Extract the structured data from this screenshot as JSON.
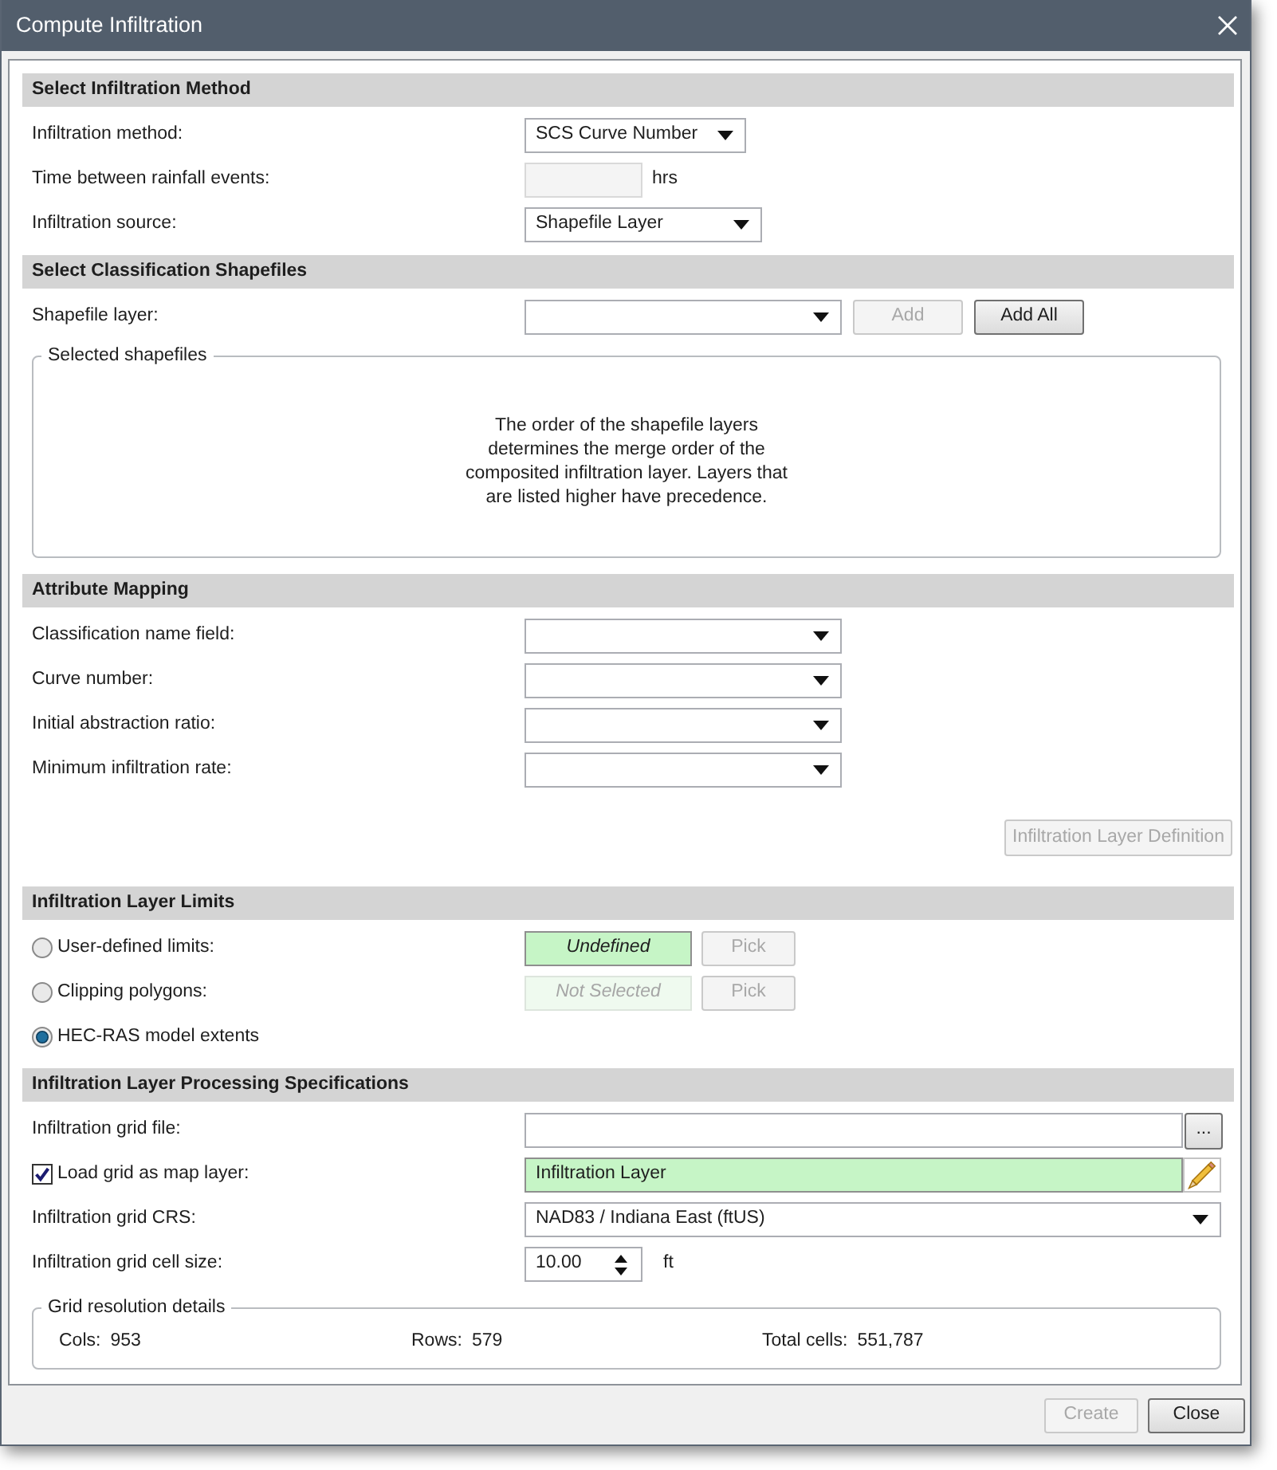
{
  "window": {
    "title": "Compute Infiltration"
  },
  "sections": [
    {
      "title": "Select Infiltration Method",
      "rows": [
        {
          "kind": "dropdown",
          "label": "Infiltration method:",
          "value": "SCS Curve Number"
        },
        {
          "kind": "number",
          "label": "Time between rainfall events:",
          "disabled": true,
          "unit": "hrs"
        },
        {
          "kind": "dropdown",
          "label": "Infiltration source:",
          "value": "Shapefile Layer"
        }
      ]
    },
    {
      "title": "Select Classification Shapefiles",
      "rows": [
        {
          "kind": "dropdown",
          "label": "Shapefile layer:",
          "buttons": [
            {
              "label": "Add",
              "disabled": true
            },
            {
              "label": "Add All",
              "disabled": false
            }
          ]
        }
      ],
      "group": {
        "kind": "message",
        "title": "Selected shapefiles",
        "message": "The order of the shapefile layers determines the merge order of the composited infiltration layer. Layers that are listed higher have precedence."
      }
    },
    {
      "title": "Attribute Mapping",
      "rows": [
        {
          "kind": "dropdown",
          "label": "Classification name field:"
        },
        {
          "kind": "dropdown",
          "label": "Curve number:"
        },
        {
          "kind": "dropdown",
          "label": "Initial abstraction ratio:"
        },
        {
          "kind": "dropdown",
          "label": "Minimum infiltration rate:"
        }
      ],
      "action_button": {
        "label": "Infiltration Layer Definition",
        "disabled": true
      }
    },
    {
      "title": "Infiltration Layer Limits",
      "rows": [
        {
          "kind": "radio",
          "label": "User-defined limits:",
          "selected": false,
          "field": {
            "value": "Undefined",
            "highlighted": true,
            "disabled": false
          },
          "button": {
            "label": "Pick",
            "disabled": true
          }
        },
        {
          "kind": "radio",
          "label": "Clipping polygons:",
          "selected": false,
          "field": {
            "value": "Not Selected",
            "highlighted": true,
            "disabled": true
          },
          "button": {
            "label": "Pick",
            "disabled": true
          }
        },
        {
          "kind": "radio",
          "label": "HEC-RAS model extents",
          "selected": true
        }
      ]
    },
    {
      "title": "Infiltration Layer Processing Specifications",
      "rows": [
        {
          "kind": "file",
          "label": "Infiltration grid file:",
          "button": {
            "label": "..."
          }
        },
        {
          "kind": "checkbox",
          "label": "Load grid as map layer:",
          "checked": true,
          "field": {
            "value": "Infiltration Layer",
            "highlighted": true
          }
        },
        {
          "kind": "dropdown",
          "label": "Infiltration grid CRS:",
          "value": "NAD83 / Indiana East (ftUS)"
        },
        {
          "kind": "spinner",
          "label": "Infiltration grid cell size:",
          "value": "10.00",
          "unit": "ft"
        }
      ],
      "group": {
        "kind": "stats",
        "title": "Grid resolution details",
        "items": [
          {
            "label": "Cols:",
            "value": "953"
          },
          {
            "label": "Rows:",
            "value": "579"
          },
          {
            "label": "Total cells:",
            "value": "551,787"
          }
        ]
      }
    }
  ],
  "footer_buttons": [
    {
      "label": "Create",
      "disabled": true
    },
    {
      "label": "Close",
      "disabled": false
    }
  ]
}
